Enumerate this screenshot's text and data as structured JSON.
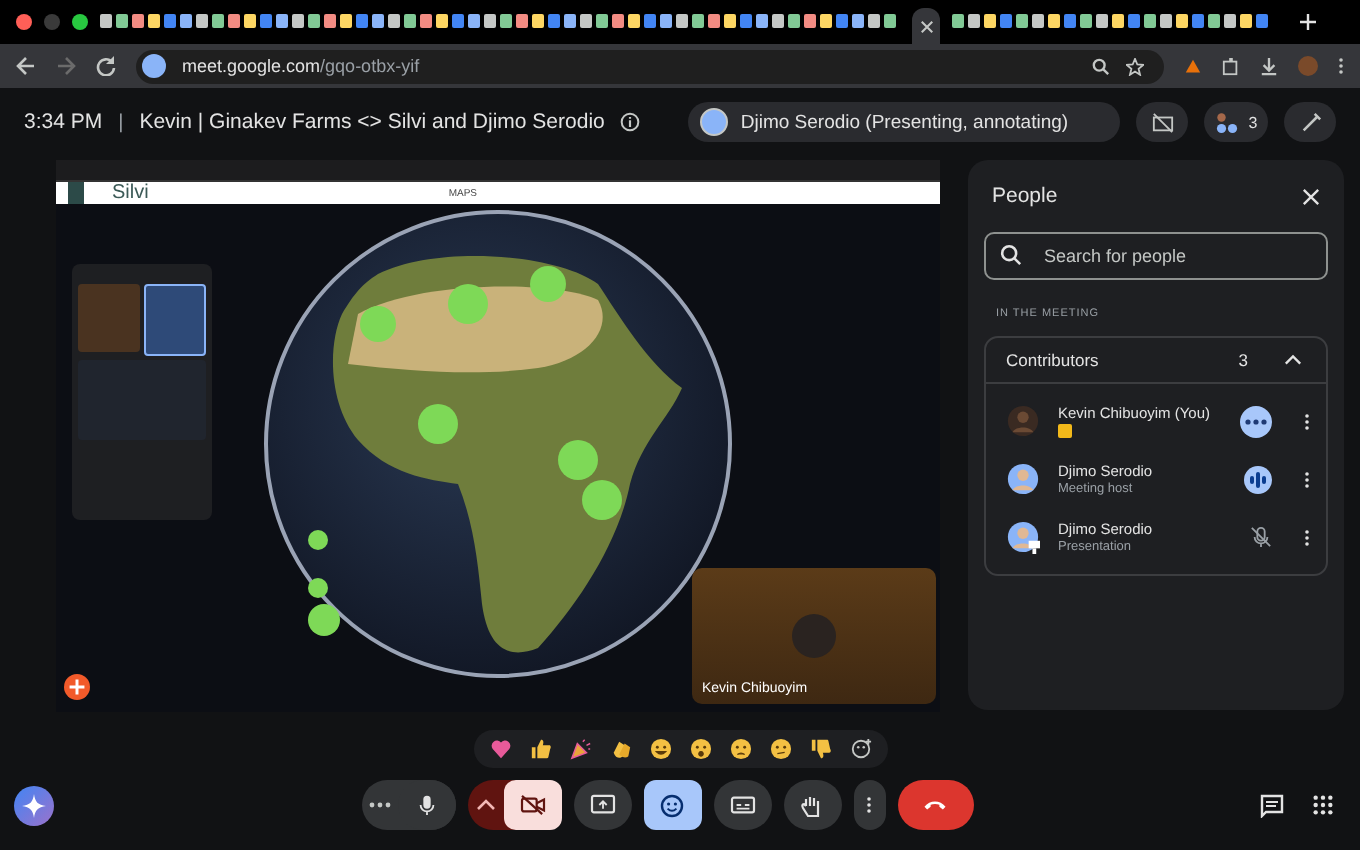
{
  "browser": {
    "url_host": "meet.google.com",
    "url_path": "/gqo-otbx-yif"
  },
  "meeting": {
    "time": "3:34 PM",
    "separator": "|",
    "title": "Kevin | Ginakev Farms <> Silvi and Djimo Serodio",
    "presenter": "Djimo Serodio (Presenting, annotating)",
    "participant_count": "3"
  },
  "shared_screen": {
    "site_logo": "Silvi",
    "nav_label": "MAPS",
    "self_view_name": "Kevin Chibuoyim"
  },
  "people_panel": {
    "title": "People",
    "search": {
      "placeholder": "Search for people"
    },
    "section_label": "IN THE MEETING",
    "group": {
      "label": "Contributors",
      "count": "3",
      "expanded": true
    },
    "participants": [
      {
        "kind": "photo",
        "name": "Kevin Chibuoyim (You)",
        "badge": true,
        "hovered": true,
        "speaking": false,
        "muted": false
      },
      {
        "kind": "person",
        "name": "Djimo Serodio",
        "detail": "Meeting host",
        "badge": false,
        "hovered": false,
        "speaking": true,
        "muted": false
      },
      {
        "kind": "presentation",
        "name": "Djimo Serodio",
        "detail": "Presentation",
        "badge": false,
        "hovered": false,
        "speaking": false,
        "muted": true
      }
    ]
  },
  "reactions": [
    {
      "kind": "heart"
    },
    {
      "kind": "thumbs-up"
    },
    {
      "kind": "party"
    },
    {
      "kind": "clap"
    },
    {
      "kind": "laugh"
    },
    {
      "kind": "surprised"
    },
    {
      "kind": "sad"
    },
    {
      "kind": "thinking"
    },
    {
      "kind": "thumbs-down"
    },
    {
      "kind": "more-emoji"
    }
  ],
  "controls": [
    {
      "kind": "mic",
      "on": true
    },
    {
      "kind": "camera",
      "on": false
    },
    {
      "kind": "present"
    },
    {
      "kind": "reactions",
      "on": true
    },
    {
      "kind": "captions",
      "on": false
    },
    {
      "kind": "hand",
      "on": false
    },
    {
      "kind": "more"
    },
    {
      "kind": "end-call"
    }
  ]
}
